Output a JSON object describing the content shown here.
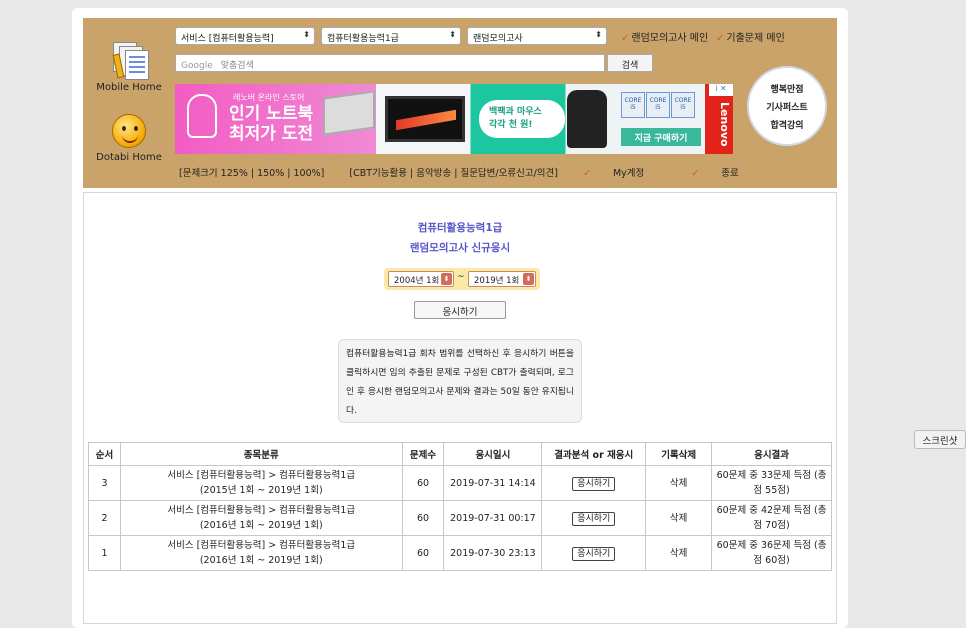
{
  "header": {
    "mobile_home": "Mobile Home",
    "dotabi_home": "Dotabi Home",
    "selects": {
      "service": "서비스 [컴퓨터활용능력]",
      "subject": "컴퓨터활용능력1급",
      "mode": "랜덤모의고사"
    },
    "top_links": [
      "랜덤모의고사 메인",
      "기출문제 메인"
    ],
    "search": {
      "brand": "Google",
      "placeholder": "맞춤검색",
      "button": "검색"
    },
    "ad": {
      "small": "레노버 온라인 스토어",
      "line1": "인기 노트북",
      "line2": "최저가 도전",
      "mid_line1": "백팩과 마우스",
      "mid_line2": "각각 천 원!",
      "chip": "CORE i5",
      "buy": "지금 구매하기",
      "brand": "Lenovo",
      "adchoices": "i ✕"
    },
    "badge": [
      "행복만점",
      "기사퍼스트",
      "합격강의"
    ],
    "bottom_links": [
      "[문제크기 125% | 150% | 100%]",
      "[CBT기능활용 | 음악방송 | 질문답변/오류신고/의견]",
      "My계정",
      "종료"
    ]
  },
  "main": {
    "title": "컴퓨터활용능력1급",
    "subtitle": "랜덤모의고사 신규응시",
    "range_from": "2004년 1회",
    "range_sep": "~",
    "range_to": "2019년 1회",
    "apply_button": "응시하기",
    "notice": "컴퓨터활용능력1급 회차 범위를 선택하신 후 응시하기 버튼을 클릭하시면 임의 추출된 문제로 구성된 CBT가 출력되며, 로그인 후 응시한 랜덤모의고사 문제와 결과는 50일 동안 유지됩니다."
  },
  "table": {
    "headers": [
      "순서",
      "종목분류",
      "문제수",
      "응시일시",
      "결과분석 or 재응시",
      "기록삭제",
      "응시결과"
    ],
    "rows": [
      {
        "no": "3",
        "cat1": "서비스 [컴퓨터활용능력] > 컴퓨터활용능력1급",
        "cat2": "(2015년 1회 ~ 2019년 1회)",
        "count": "60",
        "date": "2019-07-31 14:14",
        "btn": "응시하기",
        "del": "삭제",
        "result": "60문제 중 33문제 득점 (총점 55점)"
      },
      {
        "no": "2",
        "cat1": "서비스 [컴퓨터활용능력] > 컴퓨터활용능력1급",
        "cat2": "(2016년 1회 ~ 2019년 1회)",
        "count": "60",
        "date": "2019-07-31 00:17",
        "btn": "응시하기",
        "del": "삭제",
        "result": "60문제 중 42문제 득점 (총점 70점)"
      },
      {
        "no": "1",
        "cat1": "서비스 [컴퓨터활용능력] > 컴퓨터활용능력1급",
        "cat2": "(2016년 1회 ~ 2019년 1회)",
        "count": "60",
        "date": "2019-07-30 23:13",
        "btn": "응시하기",
        "del": "삭제",
        "result": "60문제 중 36문제 득점 (총점 60점)"
      }
    ]
  },
  "screenshot_button": "스크린샷",
  "colors": {
    "header_bg": "#c9a36a",
    "title": "#5656c8",
    "range_bg": "#fbe9a6"
  }
}
